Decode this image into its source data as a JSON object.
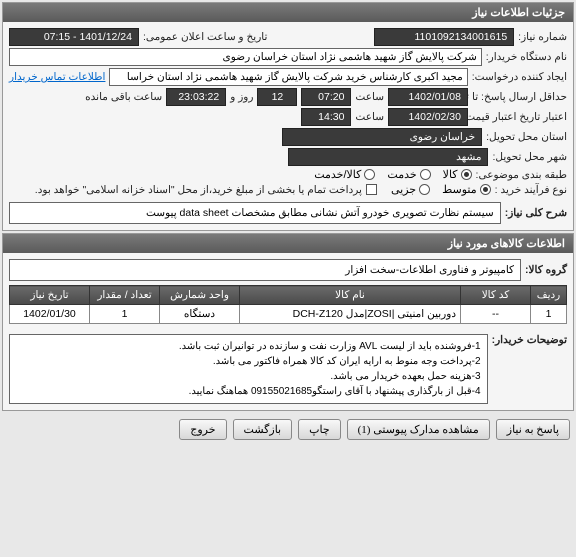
{
  "header": {
    "title": "جزئیات اطلاعات نیاز"
  },
  "fields": {
    "need_number_label": "شماره نیاز:",
    "need_number": "1101092134001615",
    "announce_label": "تاریخ و ساعت اعلان عمومی:",
    "announce_value": "1401/12/24 - 07:15",
    "buyer_org_label": "نام دستگاه خریدار:",
    "buyer_org": "شرکت پالایش گاز شهید هاشمی نژاد   استان خراسان رضوی",
    "creator_label": "ایجاد کننده درخواست:",
    "creator": "مجید اکبری کارشناس خرید شرکت پالایش گاز شهید هاشمی نژاد   استان خراسا",
    "contact_link": "اطلاعات تماس خریدار",
    "deadline_label": "حداقل ارسال پاسخ: تا تاریخ:",
    "deadline_date": "1402/01/08",
    "time_label": "ساعت",
    "deadline_time": "07:20",
    "day_and": "روز و",
    "remaining_days": "12",
    "remaining_time": "23:03:22",
    "remaining_suffix": "ساعت باقی مانده",
    "validity_label": "اعتبار تاریخ اعتبار قیمت: تا تاریخ:",
    "validity_date": "1402/02/30",
    "validity_time": "14:30",
    "delivery_province_label": "استان محل تحویل:",
    "delivery_province": "خراسان رضوی",
    "delivery_city_label": "شهر محل تحویل:",
    "delivery_city": "مشهد",
    "category_label": "طبقه بندی موضوعی:",
    "cat_goods": "کالا",
    "cat_service": "خدمت",
    "cat_both": "کالا/خدمت",
    "purchase_type_label": "نوع فرآیند خرید :",
    "pt_medium": "متوسط",
    "pt_small": "جزیی",
    "payment_note": "پرداخت تمام یا بخشی از مبلغ خرید،از محل \"اسناد خزانه اسلامی\" خواهد بود."
  },
  "description": {
    "header_label": "شرح کلی نیاز:",
    "text": "سیستم نظارت تصویری خودرو آتش نشانی مطابق مشخصات data sheet پیوست"
  },
  "goods": {
    "section_title": "اطلاعات کالاهای مورد نیاز",
    "group_label": "گروه کالا:",
    "group_value": "کامپیوتر و فناوری اطلاعات-سخت افزار",
    "columns": {
      "row": "ردیف",
      "code": "کد کالا",
      "name": "نام کالا",
      "unit": "واحد شمارش",
      "qty": "تعداد / مقدار",
      "date": "تاریخ نیاز"
    },
    "rows": [
      {
        "row": "1",
        "code": "--",
        "name": "دوربین امنیتی |ZOSI|مدل DCH-Z120",
        "unit": "دستگاه",
        "qty": "1",
        "date": "1402/01/30"
      }
    ]
  },
  "buyer_notes": {
    "label": "توضیحات خریدار:",
    "line1": "1-فروشنده باید از لیست AVL وزارت نفت و سازنده در توانیران ثبت باشد.",
    "line2": "2-پرداخت وجه منوط به ارایه ایران کد کالا همراه فاکتور می باشد.",
    "line3": "3-هزینه حمل بعهده خریدار می باشد.",
    "line4": "4-قبل از بارگذاری پیشنهاد با آقای راستگو09155021685 هماهنگ نمایید."
  },
  "buttons": {
    "respond": "پاسخ به نیاز",
    "attachments": "مشاهده مدارک پیوستی (1)",
    "print": "چاپ",
    "back": "بازگشت",
    "exit": "خروج"
  }
}
